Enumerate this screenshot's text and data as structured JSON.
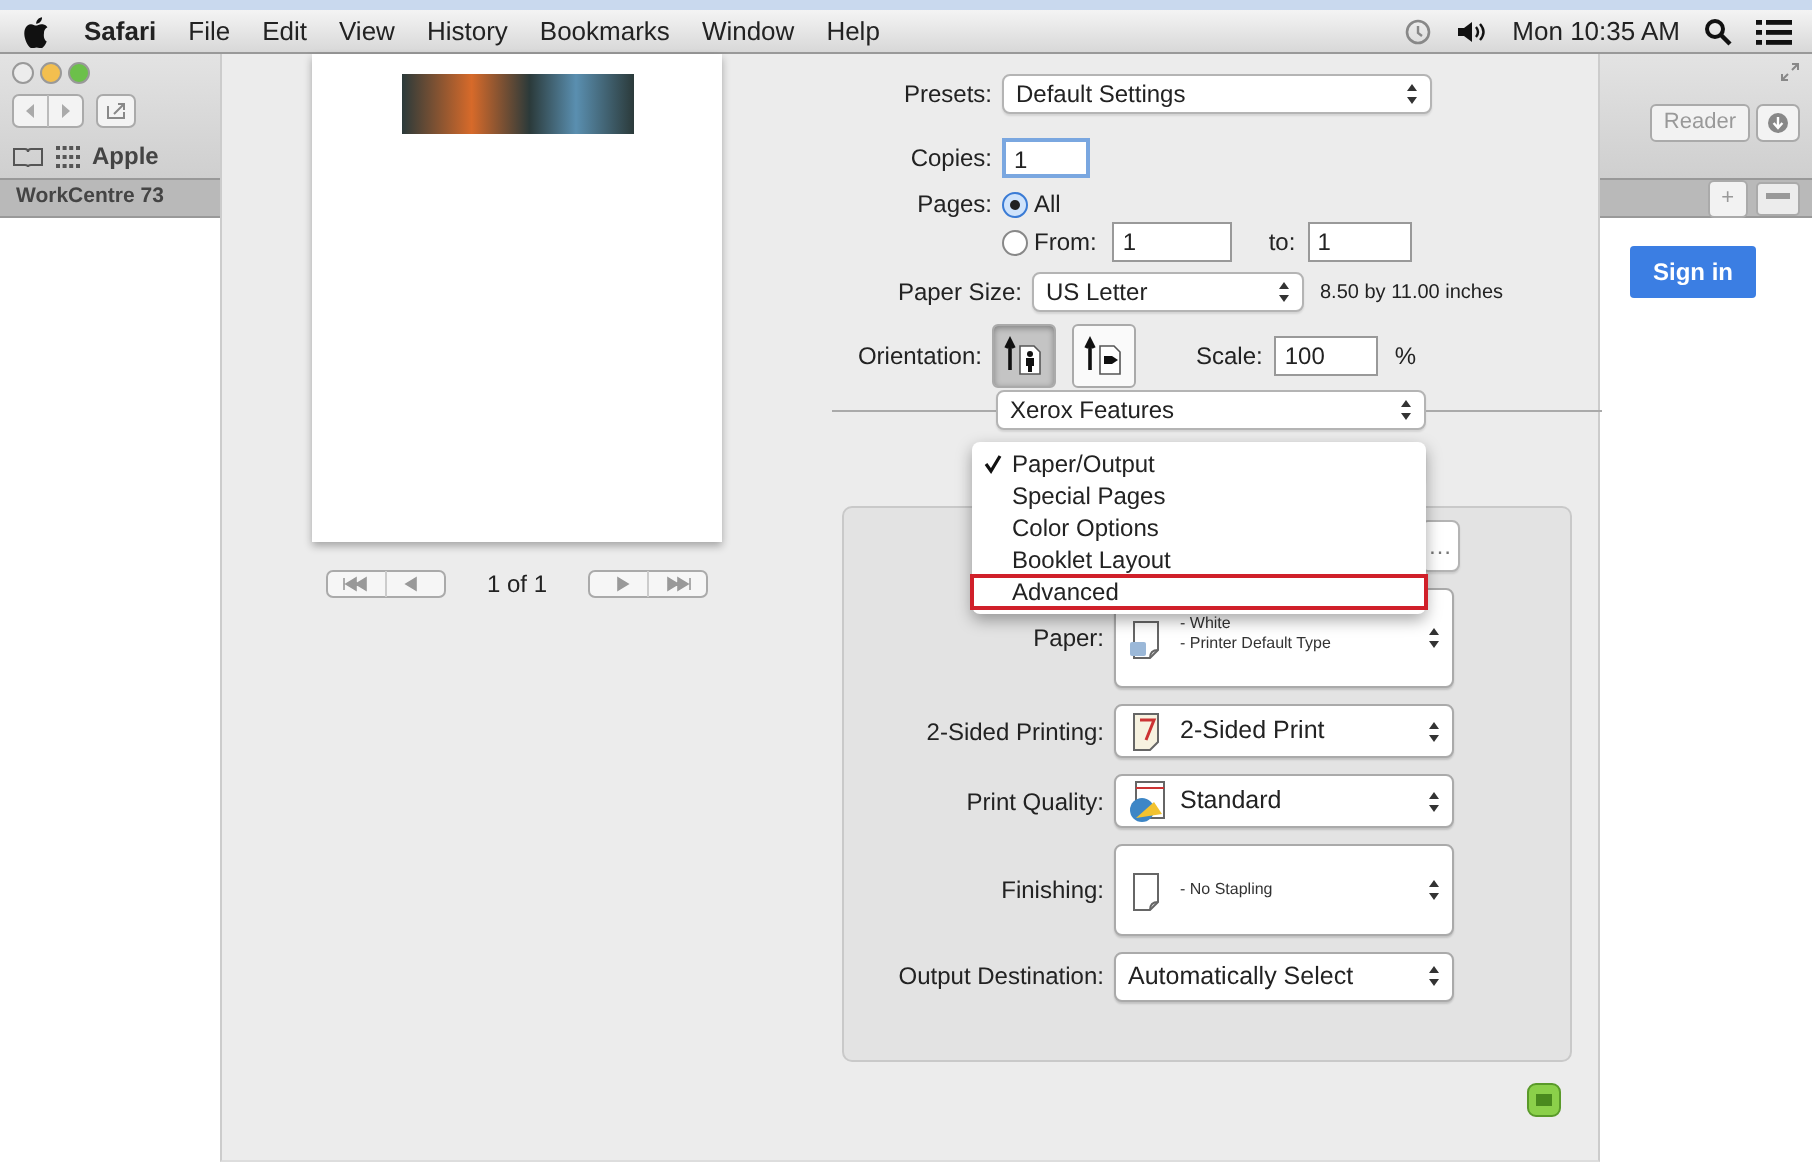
{
  "menu_bar": {
    "app": "Safari",
    "items": [
      "File",
      "Edit",
      "View",
      "History",
      "Bookmarks",
      "Window",
      "Help"
    ],
    "clock": "Mon 10:35 AM"
  },
  "browser": {
    "bookmark": "Apple",
    "tab": "WorkCentre 73",
    "reader": "Reader",
    "new_tab": "+",
    "sign_in": "Sign in"
  },
  "print_dialog": {
    "preview": {
      "page_indicator": "1 of 1"
    },
    "presets": {
      "label": "Presets:",
      "value": "Default Settings"
    },
    "copies": {
      "label": "Copies:",
      "value": "1"
    },
    "pages": {
      "label": "Pages:",
      "options": [
        {
          "label": "All",
          "selected": true
        },
        {
          "label": "From:",
          "selected": false
        }
      ],
      "from": "1",
      "to_label": "to:",
      "to": "1"
    },
    "paper_size": {
      "label": "Paper Size:",
      "value": "US Letter",
      "dimensions": "8.50 by 11.00 inches"
    },
    "orientation": {
      "label": "Orientation:",
      "options": [
        {
          "kind": "portrait",
          "selected": true
        },
        {
          "kind": "landscape",
          "selected": false
        }
      ]
    },
    "scale": {
      "label": "Scale:",
      "value": "100",
      "unit": "%"
    },
    "section": {
      "value": "Xerox Features"
    },
    "section_menu": [
      {
        "label": "Paper/Output",
        "checked": true,
        "highlighted": false
      },
      {
        "label": "Special Pages",
        "checked": false,
        "highlighted": false
      },
      {
        "label": "Color Options",
        "checked": false,
        "highlighted": false
      },
      {
        "label": "Booklet Layout",
        "checked": false,
        "highlighted": false
      },
      {
        "label": "Advanced",
        "checked": false,
        "highlighted": true
      }
    ],
    "more_button": "…",
    "settings": [
      {
        "label": "Paper:",
        "kind": "paper",
        "lines": [
          "- White",
          "- Printer Default Type"
        ]
      },
      {
        "label": "2-Sided Printing:",
        "kind": "duplex",
        "value": "2-Sided Print"
      },
      {
        "label": "Print Quality:",
        "kind": "quality",
        "value": "Standard"
      },
      {
        "label": "Finishing:",
        "kind": "finishing",
        "lines": [
          "- No Stapling"
        ]
      },
      {
        "label": "Output Destination:",
        "kind": "plain",
        "value": "Automatically Select"
      }
    ]
  }
}
